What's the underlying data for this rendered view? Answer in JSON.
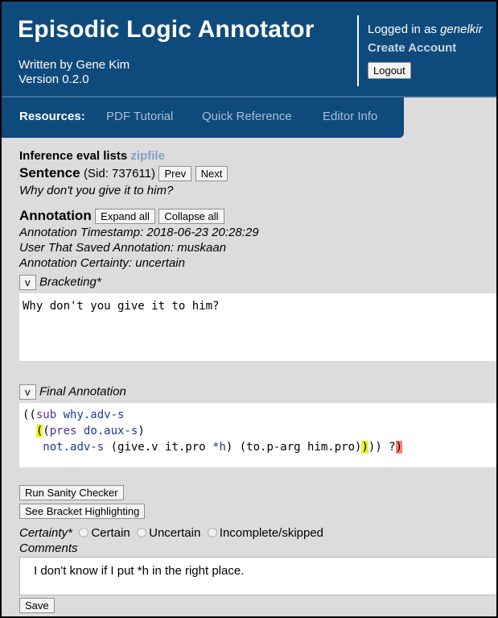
{
  "header": {
    "title": "Episodic Logic Annotator",
    "author": "Written by Gene Kim",
    "version": "Version 0.2.0",
    "logged_in_prefix": "Logged in as ",
    "username": "genelkir",
    "create_account": "Create Account",
    "logout": "Logout"
  },
  "resources": {
    "label": "Resources:",
    "links": [
      "PDF Tutorial",
      "Quick Reference",
      "Editor Info"
    ]
  },
  "inference": {
    "label": "Inference eval lists",
    "link": "zipfile"
  },
  "sentence": {
    "label": "Sentence",
    "sid_text": "(Sid: 737611)",
    "prev": "Prev",
    "next": "Next",
    "text": "Why don't you give it to him?"
  },
  "annotation": {
    "label": "Annotation",
    "expand": "Expand all",
    "collapse": "Collapse all",
    "timestamp": "Annotation Timestamp: 2018-06-23 20:28:29",
    "user": "User That Saved Annotation: muskaan",
    "certainty": "Annotation Certainty: uncertain"
  },
  "bracketing": {
    "toggle": "v",
    "label": "Bracketing*",
    "value": "Why don't you give it to him?"
  },
  "final_annotation": {
    "toggle": "v",
    "label": "Final Annotation",
    "tokens": {
      "l1_open": "((",
      "l1_sub": "sub",
      "l1_space": " ",
      "l1_why": "why.adv-s",
      "l2_indent": "  ",
      "l2_hl": "(",
      "l2_open": "(",
      "l2_pres": "pres",
      "l2_space": " ",
      "l2_do": "do.aux-s",
      "l2_close": ")",
      "l3_indent": "   ",
      "l3_not": "not.adv-s",
      "l3_mid1": " (give.v it.pro ",
      "l3_h": "*h",
      "l3_mid2": ") (to.p-arg him.pro)",
      "l3_hl": ")",
      "l3_mid3": ")) ?",
      "l3_red": ")"
    }
  },
  "buttons": {
    "sanity": "Run Sanity Checker",
    "bracket": "See Bracket Highlighting",
    "save": "Save"
  },
  "certainty": {
    "label": "Certainty*",
    "options": [
      "Certain",
      "Uncertain",
      "Incomplete/skipped"
    ]
  },
  "comments": {
    "label": "Comments",
    "value": "I don't know if I put *h in the right place."
  }
}
